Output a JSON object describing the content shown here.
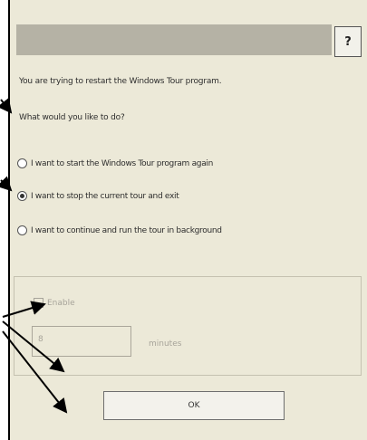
{
  "dialog": {
    "help_label": "?",
    "message_line1": "You are trying to restart the Windows Tour program.",
    "message_line2": "What would you like to do?",
    "options": [
      {
        "label": "I want to start the Windows Tour program again",
        "checked": false
      },
      {
        "label": "I want to stop the current tour and exit",
        "checked": true
      },
      {
        "label": "I want to continue and run the tour in background",
        "checked": false
      }
    ],
    "countdown": {
      "checkbox_label": "Enable",
      "value": "8",
      "unit_label": "minutes"
    },
    "ok_label": "OK"
  },
  "colors": {
    "dialog_bg": "#ece9d8",
    "titlebar": "#b5b2a5",
    "arrow": "#000000"
  },
  "icons": [
    "help-icon",
    "arrow-icon"
  ]
}
